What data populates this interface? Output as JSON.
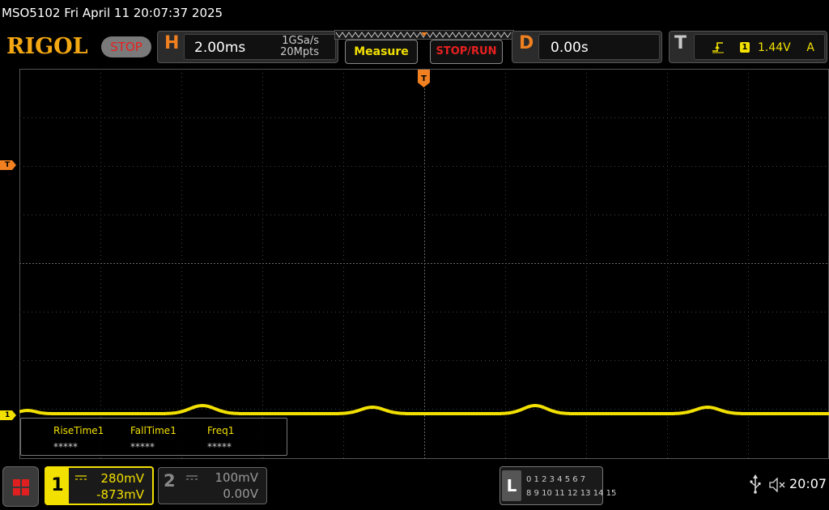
{
  "titlebar": {
    "text": "MSO5102  Fri April 11 20:07:37 2025"
  },
  "logo": "RIGOL",
  "run_state": "STOP",
  "horizontal": {
    "letter": "H",
    "timebase": "2.00ms",
    "sample_rate": "1GSa/s",
    "memory_depth": "20Mpts"
  },
  "buttons": {
    "measure": "Measure",
    "stop_run": "STOP/RUN"
  },
  "delay": {
    "letter": "D",
    "value": "0.00s"
  },
  "trigger": {
    "letter": "T",
    "source": "1",
    "level": "1.44V",
    "mode": "A",
    "marker_label": "T"
  },
  "channel_marker": "1",
  "measurements": [
    {
      "name": "RiseTime1",
      "value": "*****"
    },
    {
      "name": "FallTime1",
      "value": "*****"
    },
    {
      "name": "Freq1",
      "value": "*****"
    }
  ],
  "channels": [
    {
      "num": "1",
      "scale": "280mV",
      "offset": "-873mV",
      "active": true
    },
    {
      "num": "2",
      "scale": "100mV",
      "offset": "0.00V",
      "active": false
    }
  ],
  "logic_analyzer": {
    "letter": "L",
    "row1": "0 1 2 3   4 5 6 7",
    "row2": "8 9 10 11 12 13 14 15"
  },
  "status": {
    "time": "20:07"
  },
  "icons": {
    "menu": "menu-grid-icon",
    "usb": "usb-icon",
    "speaker": "speaker-muted-icon",
    "edge": "rising-edge-icon"
  },
  "colors": {
    "ch1": "#f2e000",
    "trigger": "#f08020",
    "stop": "#e82020",
    "logo": "#f3a712"
  },
  "waveform": {
    "channel": "1",
    "shape": "flat line with small periodic bumps"
  }
}
